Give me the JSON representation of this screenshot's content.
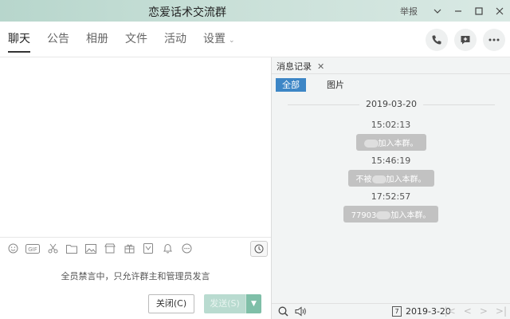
{
  "window": {
    "title": "恋爱话术交流群",
    "report_label": "举报",
    "controls": [
      "chevron-down-icon",
      "minimize-icon",
      "maximize-icon",
      "close-icon"
    ]
  },
  "nav": {
    "tabs": [
      {
        "label": "聊天"
      },
      {
        "label": "公告"
      },
      {
        "label": "相册"
      },
      {
        "label": "文件"
      },
      {
        "label": "活动"
      },
      {
        "label": "设置"
      }
    ],
    "icons": [
      "phone-icon",
      "add-chat-icon",
      "more-icon"
    ]
  },
  "composer": {
    "toolbar_icons": [
      "emoji-icon",
      "gif-icon",
      "scissors-icon",
      "folder-icon",
      "image-icon",
      "shop-icon",
      "gift-icon",
      "voice-note-icon",
      "bell-icon",
      "more-circle-icon"
    ],
    "muted_notice": "全员禁言中，只允许群主和管理员发言",
    "close_label": "关闭(C)",
    "send_label": "发送(S)"
  },
  "history": {
    "tab_label": "消息记录",
    "filters": [
      {
        "label": "全部",
        "active": true
      },
      {
        "label": "图片",
        "active": false
      }
    ],
    "date_header": "2019-03-20",
    "messages": [
      {
        "time": "15:02:13",
        "prefix": "",
        "text": "加入本群。"
      },
      {
        "time": "15:46:19",
        "prefix": "不被",
        "text": "加入本群。"
      },
      {
        "time": "17:52:57",
        "prefix": "77903",
        "text": "加入本群。"
      }
    ],
    "bottom_date": "2019-3-20",
    "calendar_day": "7"
  },
  "colors": {
    "titlebar": "#c9e0d8",
    "filter_active": "#3d86c6",
    "send_disabled": "#b9dbd0",
    "system_pill": "#c2c2c2"
  }
}
